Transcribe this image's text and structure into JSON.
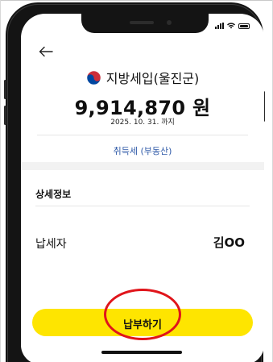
{
  "status_bar": {
    "signal_icon": "cellular-signal-icon",
    "wifi_icon": "wifi-icon",
    "battery_icon": "battery-icon"
  },
  "nav": {
    "back_icon": "back-arrow-icon"
  },
  "header": {
    "org_icon": "korea-government-emblem-icon",
    "org_name": "지방세입(울진군)",
    "amount": "9,914,870 원",
    "due_date": "2025. 10. 31. 까지",
    "tax_type": "취득세 (부동산)"
  },
  "details": {
    "section_title": "상세정보",
    "payer_label": "납세자",
    "payer_name": "김OO"
  },
  "action": {
    "pay_label": "납부하기"
  },
  "colors": {
    "button_yellow": "#fee500",
    "link_blue": "#2f5aa8",
    "highlight_red": "#e0151b",
    "emblem_red": "#cd2e3a",
    "emblem_blue": "#0047a0"
  }
}
